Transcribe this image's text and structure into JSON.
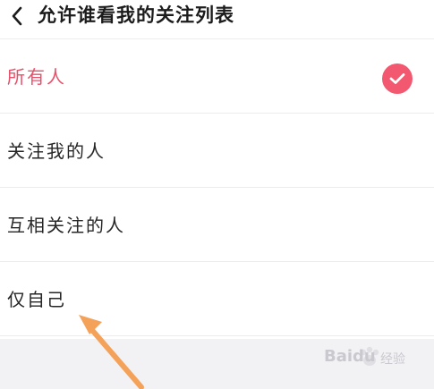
{
  "header": {
    "title": "允许谁看我的关注列表",
    "back_icon": "chevron-left-icon"
  },
  "options": [
    {
      "label": "所有人",
      "selected": true
    },
    {
      "label": "关注我的人",
      "selected": false
    },
    {
      "label": "互相关注的人",
      "selected": false
    },
    {
      "label": "仅自己",
      "selected": false
    }
  ],
  "selected_icon": "check-circle-icon",
  "watermark": {
    "brand": "Baidu",
    "suffix": "经验"
  },
  "colors": {
    "accent": "#f2586f",
    "selected_text": "#e8506a",
    "arrow": "#f4a25a"
  }
}
